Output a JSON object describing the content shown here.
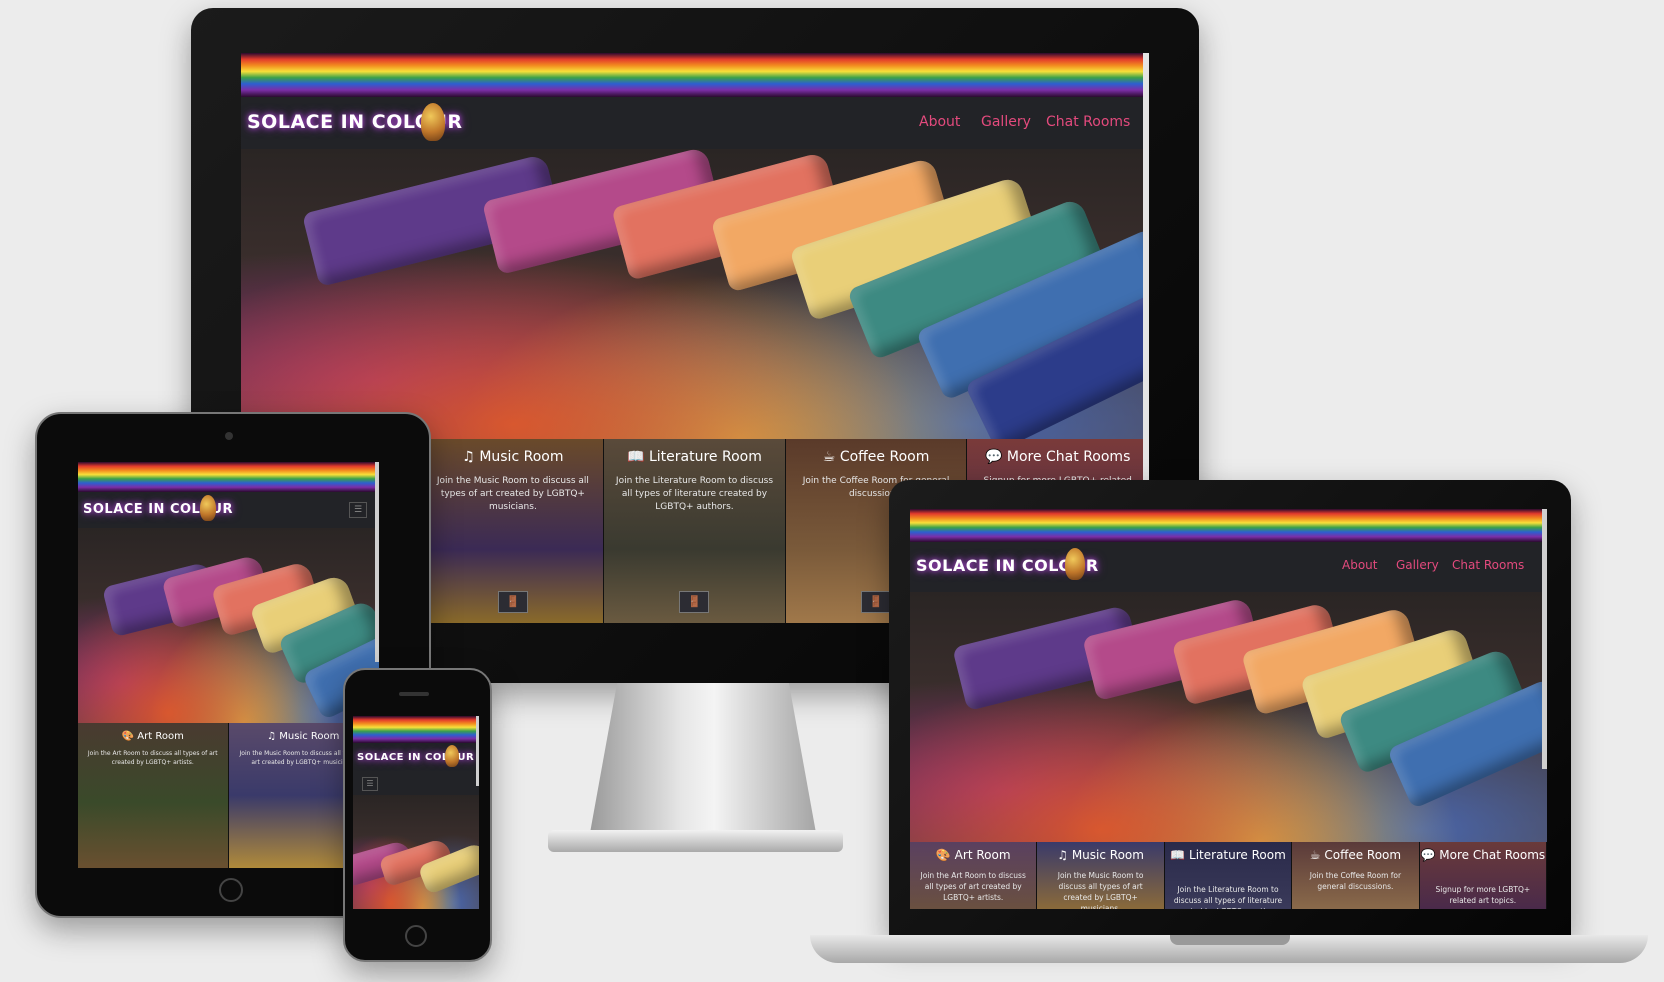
{
  "site": {
    "brand": "SOLACE IN COLOUR",
    "nav": [
      "About",
      "Gallery",
      "Chat Rooms"
    ]
  },
  "rooms": {
    "art": {
      "title": "Art Room",
      "desc": "Join the Art Room to discuss all types of art created by LGBTQ+ artists."
    },
    "music": {
      "title": "Music Room",
      "desc": "Join the Music Room to discuss all types of art created by LGBTQ+ musicians."
    },
    "literature": {
      "title": "Literature Room",
      "desc": "Join the Literature Room to discuss all types of literature created by LGBTQ+ authors."
    },
    "coffee": {
      "title": "Coffee Room",
      "desc": "Join the Coffee Room for general discussions."
    },
    "more": {
      "title": "More Chat Rooms",
      "desc": "Signup for more LGBTQ+ related art topics."
    }
  },
  "icons": {
    "art": "🎨",
    "music": "♫",
    "literature": "📖",
    "coffee": "☕",
    "more": "💬",
    "door": "🚪",
    "menu": "☰"
  },
  "colors": {
    "accent": "#e34a7d",
    "navbar": "#222327",
    "glow": "#b44bd6"
  }
}
